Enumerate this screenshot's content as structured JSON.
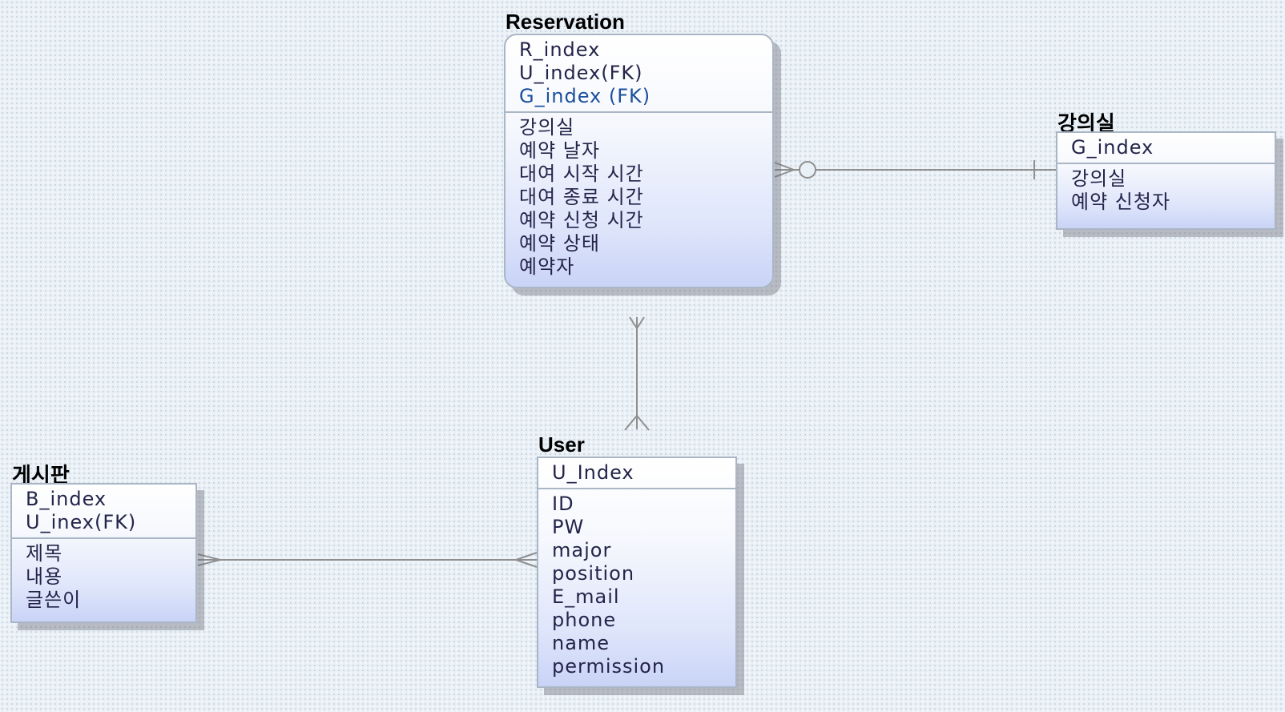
{
  "entities": {
    "reservation": {
      "title": "Reservation",
      "keys": [
        "R_index",
        "U_index(FK)",
        "G_index (FK)"
      ],
      "attributes": [
        "강의실",
        "예약 날자",
        "대여 시작 시간",
        "대여 종료 시간",
        "예약 신청 시간",
        "예약 상태",
        "예약자"
      ]
    },
    "classroom": {
      "title": "강의실",
      "keys": [
        "G_index"
      ],
      "attributes": [
        "강의실",
        "예약 신청자"
      ]
    },
    "user": {
      "title": "User",
      "keys": [
        "U_Index"
      ],
      "attributes": [
        "ID",
        "PW",
        "major",
        "position",
        "E_mail",
        "phone",
        "name",
        "permission"
      ]
    },
    "board": {
      "title": "게시판",
      "keys": [
        "B_index",
        "U_inex(FK)"
      ],
      "attributes": [
        "제목",
        "내용",
        "글쓴이"
      ]
    }
  },
  "relationships": [
    {
      "from": "reservation",
      "to": "classroom",
      "from_end": "zero-or-many",
      "to_end": "one"
    },
    {
      "from": "reservation",
      "to": "user",
      "from_end": "many",
      "to_end": "many"
    },
    {
      "from": "board",
      "to": "user",
      "from_end": "many",
      "to_end": "many"
    }
  ],
  "colors": {
    "background": "#e9f0f6",
    "entity_border": "#a9b6c6",
    "attribute_text": "#24244a",
    "fk_text": "#1a4f9c",
    "connector": "#8f8f8f"
  }
}
